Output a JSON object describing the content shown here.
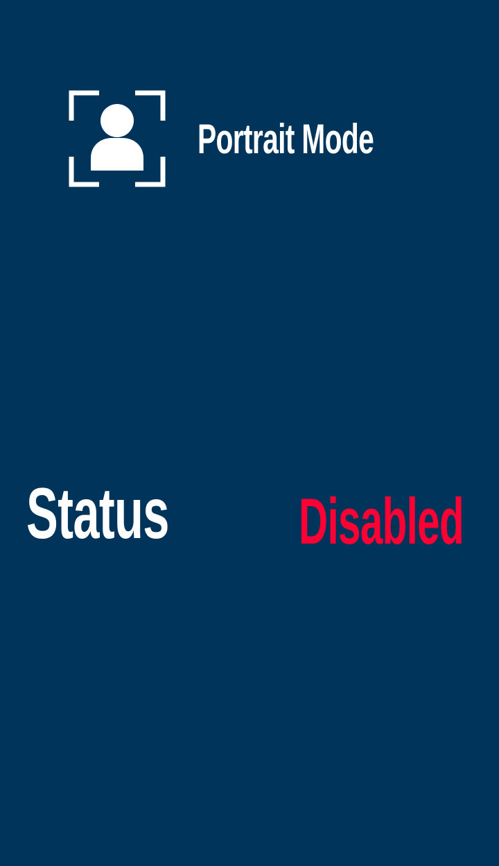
{
  "header": {
    "icon": "portrait-mode-icon",
    "title": "Portrait Mode"
  },
  "status": {
    "label": "Status",
    "value": "Disabled"
  },
  "colors": {
    "background": "#00345a",
    "text": "#ffffff",
    "status_disabled": "#ff0035"
  }
}
